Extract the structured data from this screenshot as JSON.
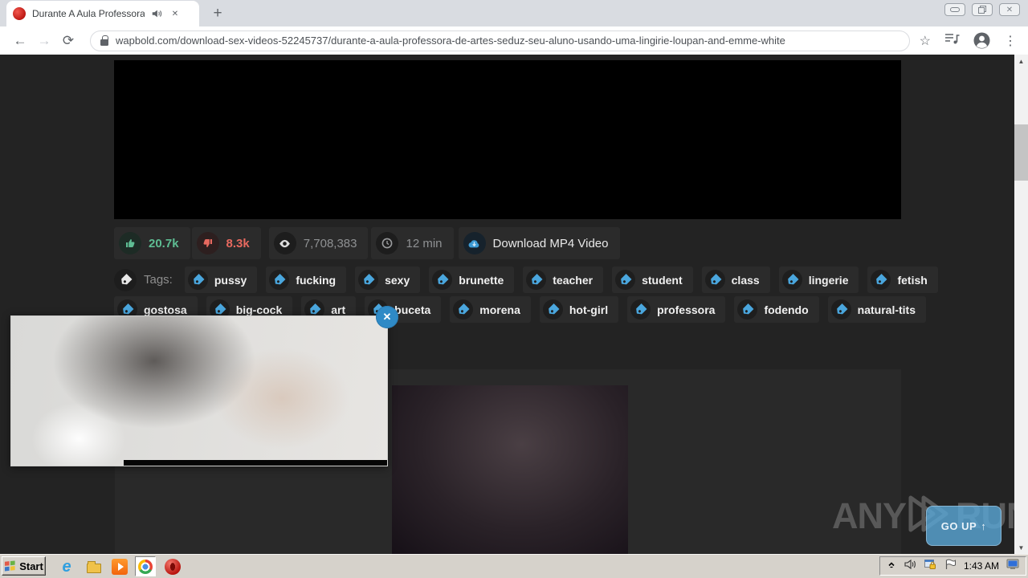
{
  "browser": {
    "tab": {
      "title": "Durante A Aula Professora De A"
    },
    "url": "wapbold.com/download-sex-videos-52245737/durante-a-aula-professora-de-artes-seduz-seu-aluno-usando-uma-lingirie-loupan-and-emme-white"
  },
  "icons": {
    "back": "←",
    "forward": "→",
    "refresh": "⟳",
    "new_tab": "+",
    "tab_close": "✕",
    "bookmark_star": "☆",
    "menu_kebab": "⋮",
    "win_close": "✕",
    "popup_close": "✕",
    "scroll_up": "▲",
    "scroll_down": "▼",
    "go_up_arrow": "↑"
  },
  "page": {
    "stats": {
      "likes": "20.7k",
      "dislikes": "8.3k",
      "views": "7,708,383",
      "duration": "12 min",
      "download_label": "Download MP4 Video"
    },
    "tags_label": "Tags:",
    "tags_row1": [
      "pussy",
      "fucking",
      "sexy",
      "brunette",
      "teacher",
      "student",
      "class",
      "lingerie",
      "fetish"
    ],
    "tags_row2": [
      "gostosa",
      "big-cock",
      "art",
      "buceta",
      "morena",
      "hot-girl",
      "professora",
      "fodendo",
      "natural-tits"
    ]
  },
  "overlay": {
    "watermark_left": "ANY",
    "watermark_right": "RUN",
    "go_up_label": "GO UP"
  },
  "taskbar": {
    "start_label": "Start",
    "clock": "1:43 AM"
  },
  "colors": {
    "accent_blue": "#3d9bd5",
    "tag_blue": "#4aa6dd",
    "like_green": "#5ebd93",
    "dislike_red": "#e8695f",
    "page_bg": "#232323",
    "panel_bg": "#292929",
    "pill_bg": "#2b2b2b",
    "go_up_blue": "#5aa8d7"
  }
}
